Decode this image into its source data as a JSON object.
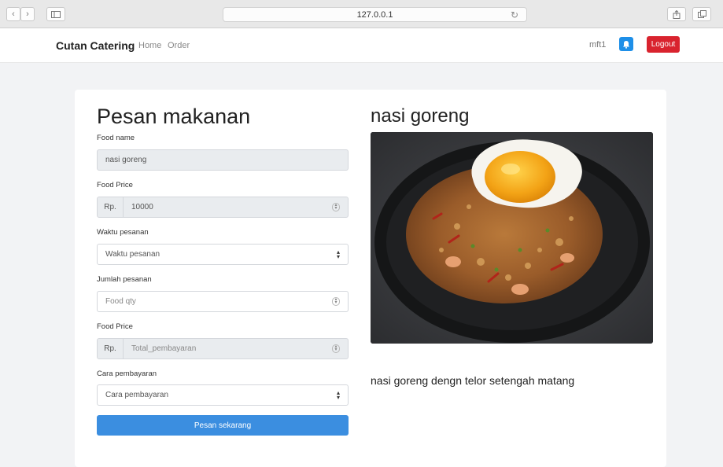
{
  "browser": {
    "url": "127.0.0.1",
    "back_icon": "chevron-left-icon",
    "forward_icon": "chevron-right-icon",
    "sidebar_icon": "sidebar-icon",
    "reload_icon": "reload-icon",
    "share_icon": "share-icon",
    "tabs_icon": "tabs-icon"
  },
  "navbar": {
    "brand": "Cutan Catering",
    "links": [
      "Home",
      "Order"
    ],
    "username": "mft1",
    "bell_icon": "bell-icon",
    "logout": "Logout",
    "logout_color": "#d9232e"
  },
  "form": {
    "heading": "Pesan makanan",
    "food_name_label": "Food name",
    "food_name_value": "nasi goreng",
    "food_price_label": "Food Price",
    "currency_prefix": "Rp.",
    "food_price_value": "10000",
    "waktu_label": "Waktu pesanan",
    "waktu_value": "Waktu pesanan",
    "jumlah_label": "Jumlah pesanan",
    "jumlah_placeholder": "Food qty",
    "total_label": "Food Price",
    "total_placeholder": "Total_pembayaran",
    "cara_label": "Cara pembayaran",
    "cara_value": "Cara pembayaran",
    "submit": "Pesan sekarang",
    "submit_color": "#3b8ee0"
  },
  "food": {
    "title": "nasi goreng",
    "description": "nasi goreng dengn telor setengah matang"
  }
}
